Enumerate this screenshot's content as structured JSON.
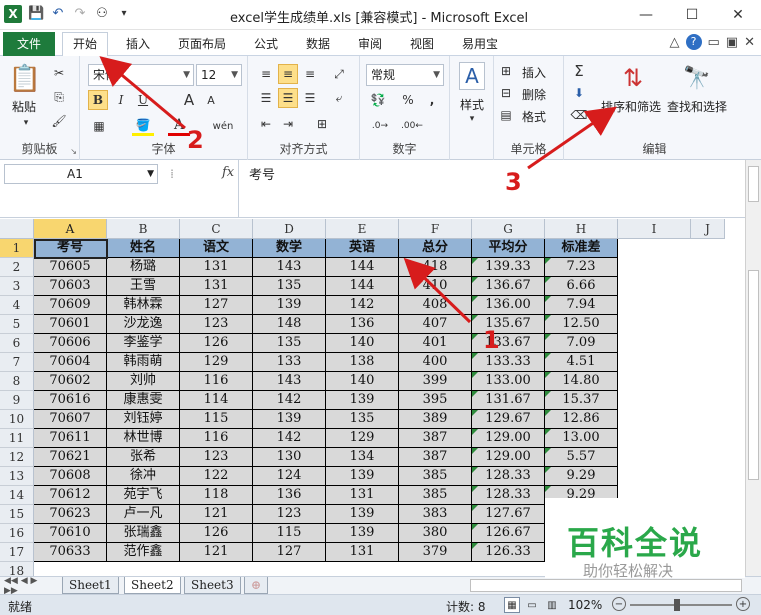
{
  "window": {
    "title": "excel学生成绩单.xls  [兼容模式] - Microsoft Excel",
    "logo": "X"
  },
  "tabs": [
    "文件",
    "开始",
    "插入",
    "页面布局",
    "公式",
    "数据",
    "审阅",
    "视图",
    "易用宝"
  ],
  "ribbon": {
    "clipboard": {
      "label": "剪贴板",
      "paste": "粘贴"
    },
    "font": {
      "label": "字体",
      "name": "宋体",
      "size": "12",
      "bold": "B",
      "italic": "I",
      "underline": "U",
      "grow": "A",
      "shrink": "A",
      "fontcolor": "A",
      "wen": "wén"
    },
    "align": {
      "label": "对齐方式"
    },
    "number": {
      "label": "数字",
      "format": "常规",
      "percent": "%",
      "comma": ","
    },
    "styles": {
      "label": "样式"
    },
    "cells": {
      "label": "单元格",
      "insert": "插入",
      "delete": "删除",
      "format": "格式"
    },
    "edit": {
      "label": "编辑",
      "sum": "Σ",
      "sort_filter": "排序和筛选",
      "find_select": "查找和选择"
    }
  },
  "formula": {
    "cell_ref": "A1",
    "fx": "fx",
    "content": "考号"
  },
  "columns": [
    "A",
    "B",
    "C",
    "D",
    "E",
    "F",
    "G",
    "H",
    "I",
    "J"
  ],
  "rows": [
    "1",
    "2",
    "3",
    "4",
    "5",
    "6",
    "7",
    "8",
    "9",
    "10",
    "11",
    "12",
    "13",
    "14",
    "15",
    "16",
    "17",
    "18"
  ],
  "table": {
    "headers": [
      "考号",
      "姓名",
      "语文",
      "数学",
      "英语",
      "总分",
      "平均分",
      "标准差"
    ],
    "data": [
      [
        "70605",
        "杨璐",
        "131",
        "143",
        "144",
        "418",
        "139.33",
        "7.23"
      ],
      [
        "70603",
        "王雪",
        "131",
        "135",
        "144",
        "410",
        "136.67",
        "6.66"
      ],
      [
        "70609",
        "韩林霖",
        "127",
        "139",
        "142",
        "408",
        "136.00",
        "7.94"
      ],
      [
        "70601",
        "沙龙逸",
        "123",
        "148",
        "136",
        "407",
        "135.67",
        "12.50"
      ],
      [
        "70606",
        "李鉴学",
        "126",
        "135",
        "140",
        "401",
        "133.67",
        "7.09"
      ],
      [
        "70604",
        "韩雨萌",
        "129",
        "133",
        "138",
        "400",
        "133.33",
        "4.51"
      ],
      [
        "70602",
        "刘帅",
        "116",
        "143",
        "140",
        "399",
        "133.00",
        "14.80"
      ],
      [
        "70616",
        "康惠雯",
        "114",
        "142",
        "139",
        "395",
        "131.67",
        "15.37"
      ],
      [
        "70607",
        "刘钰婷",
        "115",
        "139",
        "135",
        "389",
        "129.67",
        "12.86"
      ],
      [
        "70611",
        "林世博",
        "116",
        "142",
        "129",
        "387",
        "129.00",
        "13.00"
      ],
      [
        "70621",
        "张希",
        "123",
        "130",
        "134",
        "387",
        "129.00",
        "5.57"
      ],
      [
        "70608",
        "徐冲",
        "122",
        "124",
        "139",
        "385",
        "128.33",
        "9.29"
      ],
      [
        "70612",
        "苑宇飞",
        "118",
        "136",
        "131",
        "385",
        "128.33",
        "9.29"
      ],
      [
        "70623",
        "卢一凡",
        "121",
        "123",
        "139",
        "383",
        "127.67",
        ""
      ],
      [
        "70610",
        "张瑞鑫",
        "126",
        "115",
        "139",
        "380",
        "126.67",
        ""
      ],
      [
        "70633",
        "范作鑫",
        "121",
        "127",
        "131",
        "379",
        "126.33",
        ""
      ]
    ]
  },
  "sheets": [
    "Sheet1",
    "Sheet2",
    "Sheet3"
  ],
  "status": {
    "ready": "就绪",
    "count": "计数: 8",
    "zoom": "102%"
  },
  "annotations": {
    "n1": "1",
    "n2": "2",
    "n3": "3"
  },
  "watermark": {
    "title": "百科全说",
    "subtitle": "助你轻松解决"
  }
}
